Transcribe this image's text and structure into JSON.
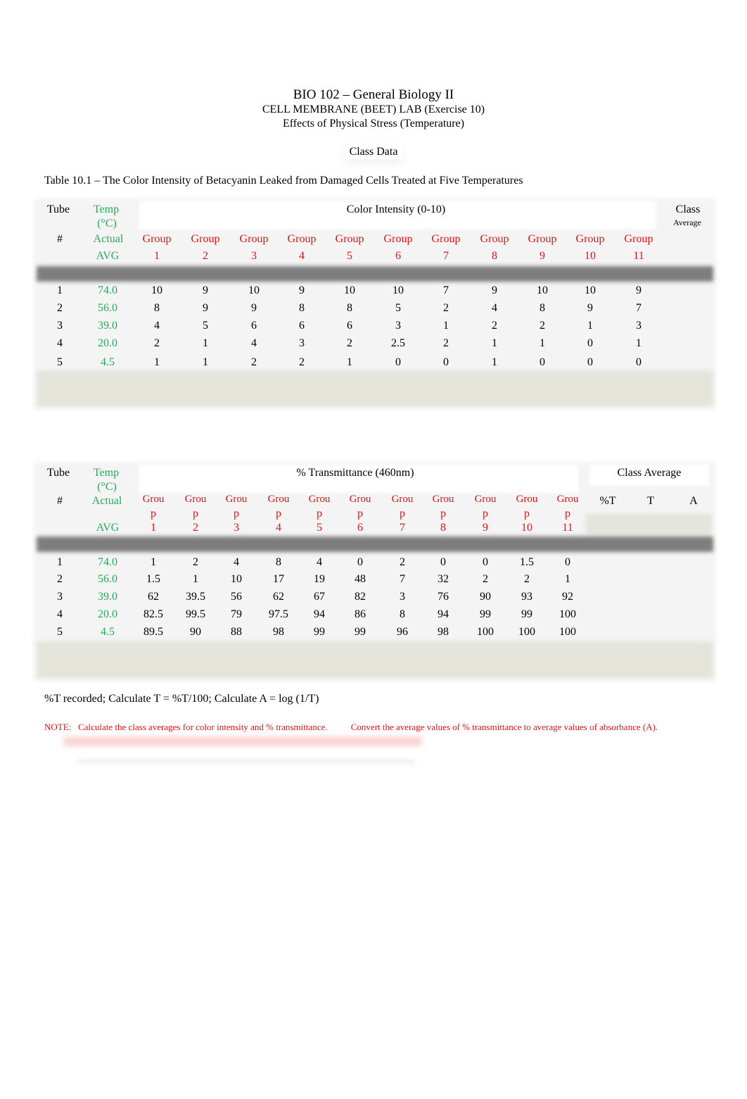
{
  "header": {
    "course": "BIO 102 – General Biology II",
    "lab": "CELL MEMBRANE (BEET) LAB (Exercise 10)",
    "subtitle": "Effects of Physical Stress (Temperature)",
    "section": "Class Data",
    "table_caption": "Table 10.1 – The Color Intensity of Betacyanin Leaked from Damaged Cells Treated at Five Temperatures"
  },
  "colors": {
    "temp_text": "#1fae55",
    "group_text": "#ee1111",
    "note_text": "#ee1111",
    "separator_band": "#7d7d7d"
  },
  "table1": {
    "headers": {
      "tube": "Tube",
      "hash": "#",
      "temp_line1": "Temp",
      "temp_line2": "(°C)",
      "temp_line3": "Actual",
      "temp_line4": "AVG",
      "span_title": "Color Intensity (0-10)",
      "class_line1": "Class",
      "class_line2": "Average",
      "group_word": "Group",
      "groups": [
        "1",
        "2",
        "3",
        "4",
        "5",
        "6",
        "7",
        "8",
        "9",
        "10",
        "11"
      ]
    },
    "rows": [
      {
        "tube": "1",
        "temp": "74.0",
        "values": [
          "10",
          "9",
          "10",
          "9",
          "10",
          "10",
          "7",
          "9",
          "10",
          "10",
          "9"
        ],
        "class_avg": ""
      },
      {
        "tube": "2",
        "temp": "56.0",
        "values": [
          "8",
          "9",
          "9",
          "8",
          "8",
          "5",
          "2",
          "4",
          "8",
          "9",
          "7"
        ],
        "class_avg": ""
      },
      {
        "tube": "3",
        "temp": "39.0",
        "values": [
          "4",
          "5",
          "6",
          "6",
          "6",
          "3",
          "1",
          "2",
          "2",
          "1",
          "3"
        ],
        "class_avg": ""
      },
      {
        "tube": "4",
        "temp": "20.0",
        "values": [
          "2",
          "1",
          "4",
          "3",
          "2",
          "2.5",
          "2",
          "1",
          "1",
          "0",
          "1"
        ],
        "class_avg": ""
      },
      {
        "tube": "5",
        "temp": "4.5",
        "values": [
          "1",
          "1",
          "2",
          "2",
          "1",
          "0",
          "0",
          "1",
          "0",
          "0",
          "0"
        ],
        "class_avg": ""
      }
    ]
  },
  "table2": {
    "headers": {
      "tube": "Tube",
      "hash": "#",
      "temp_line1": "Temp",
      "temp_line2": "(°C)",
      "temp_line3": "Actual",
      "temp_line4": "AVG",
      "span_title": "% Transmittance (460nm)",
      "class_title": "Class Average",
      "class_cols": [
        "%T",
        "T",
        "A"
      ],
      "group_word_a": "Grou",
      "group_word_b": "p",
      "groups": [
        "1",
        "2",
        "3",
        "4",
        "5",
        "6",
        "7",
        "8",
        "9",
        "10",
        "11"
      ]
    },
    "rows": [
      {
        "tube": "1",
        "temp": "74.0",
        "values": [
          "1",
          "2",
          "4",
          "8",
          "4",
          "0",
          "2",
          "0",
          "0",
          "1.5",
          "0"
        ]
      },
      {
        "tube": "2",
        "temp": "56.0",
        "values": [
          "1.5",
          "1",
          "10",
          "17",
          "19",
          "48",
          "7",
          "32",
          "2",
          "2",
          "1"
        ]
      },
      {
        "tube": "3",
        "temp": "39.0",
        "values": [
          "62",
          "39.5",
          "56",
          "62",
          "67",
          "82",
          "3",
          "76",
          "90",
          "93",
          "92"
        ]
      },
      {
        "tube": "4",
        "temp": "20.0",
        "values": [
          "82.5",
          "99.5",
          "79",
          "97.5",
          "94",
          "86",
          "8",
          "94",
          "99",
          "99",
          "100"
        ]
      },
      {
        "tube": "5",
        "temp": "4.5",
        "values": [
          "89.5",
          "90",
          "88",
          "98",
          "99",
          "99",
          "96",
          "98",
          "100",
          "100",
          "100"
        ]
      }
    ]
  },
  "footer": {
    "formula": "%T recorded; Calculate T = %T/100; Calculate A = log (1/T)",
    "note_label": "NOTE:",
    "note_1": "Calculate the class averages for color intensity and % transmittance.",
    "note_2": "Convert the average values of % transmittance to average values of absorbance (A)."
  }
}
